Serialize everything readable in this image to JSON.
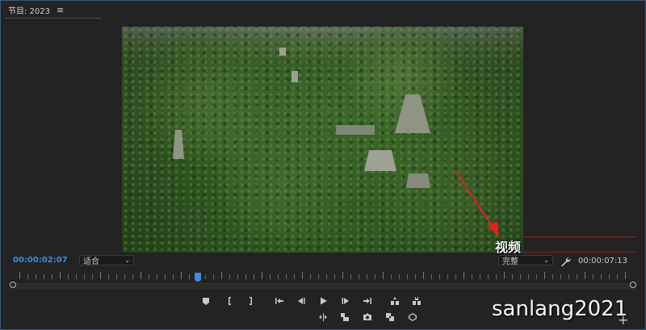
{
  "panel": {
    "title": "节目: 2023",
    "menu_icon": "hamburger-menu-icon"
  },
  "video": {
    "subtitle": "视频",
    "annotation_color": "#e02020"
  },
  "timecode": {
    "current": "00:00:02:07",
    "duration": "00:00:07:13",
    "color": "#3e8bdc"
  },
  "zoom_select": {
    "value": "适合"
  },
  "quality_select": {
    "value": "完整"
  },
  "playback": {
    "position_fraction": 0.3
  },
  "controls": {
    "row1": [
      "add-marker-icon",
      "mark-in-icon",
      "mark-out-icon",
      "go-to-in-icon",
      "step-back-icon",
      "play-icon",
      "step-forward-icon",
      "go-to-out-icon",
      "lift-icon",
      "extract-icon"
    ],
    "row2": [
      "trim-icon",
      "insert-icon",
      "export-frame-icon",
      "overwrite-icon",
      "vr-video-icon"
    ]
  },
  "watermark": "sanlang2021",
  "add_button": "+"
}
